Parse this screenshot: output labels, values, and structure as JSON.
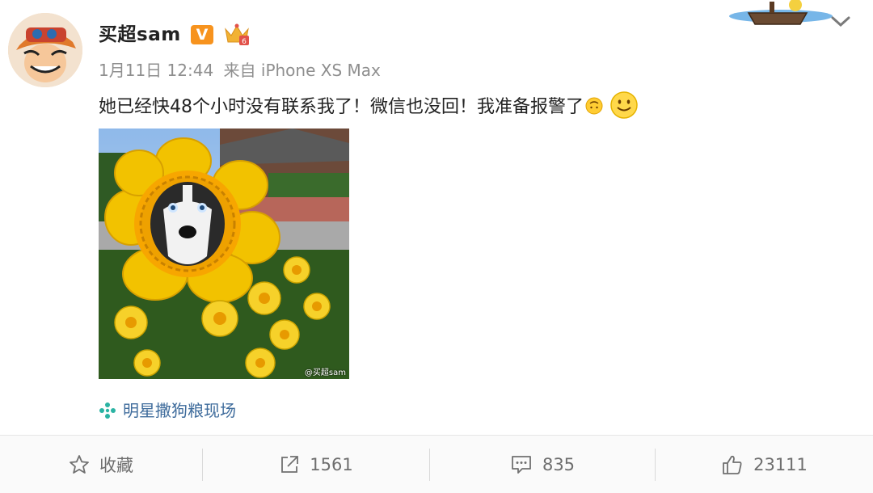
{
  "user": {
    "name": "买超sam",
    "verified_badge": "V"
  },
  "meta": {
    "time": "1月11日 12:44",
    "source": "来自 iPhone XS Max"
  },
  "post": {
    "text": "她已经快48个小时没有联系我了！微信也没回！我准备报警了"
  },
  "image": {
    "watermark": "@买超sam"
  },
  "topic": {
    "label": "明星撒狗粮现场"
  },
  "actions": {
    "favorite_label": "收藏",
    "repost_count": "1561",
    "comment_count": "835",
    "like_count": "23111"
  },
  "colors": {
    "topic_link": "#3f6c9c",
    "verified_badge": "#f7931e",
    "meta_text": "#8e8e8e"
  },
  "icons": [
    "user-avatar",
    "verified-v-icon",
    "crown-badge-icon",
    "upside-down-face-emoji",
    "smile-emoji",
    "topic-pinwheel-icon",
    "chevron-down-icon",
    "star-icon",
    "share-icon",
    "comment-icon",
    "thumbs-up-icon"
  ]
}
